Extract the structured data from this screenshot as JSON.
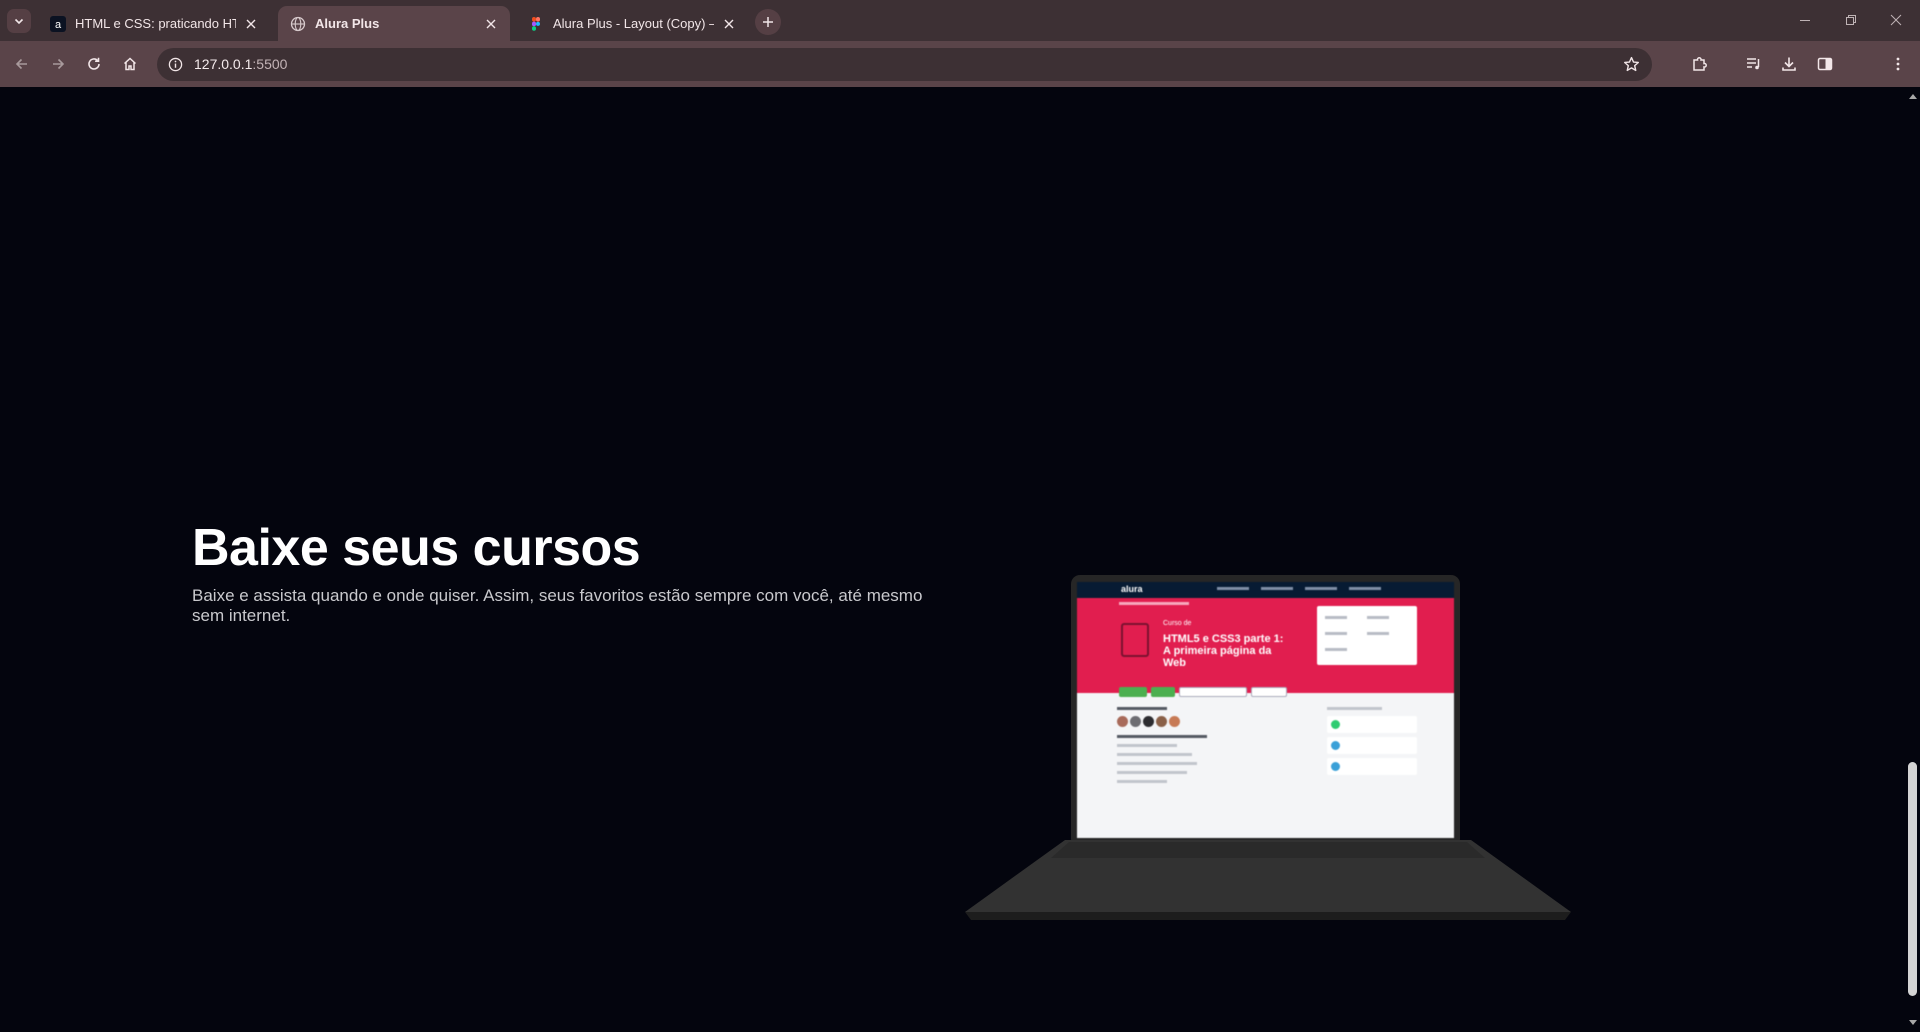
{
  "browser": {
    "tabs": [
      {
        "title": "HTML e CSS: praticando HTML",
        "favicon": "alura-icon",
        "active": false
      },
      {
        "title": "Alura Plus",
        "favicon": "globe-icon",
        "active": true
      },
      {
        "title": "Alura Plus - Layout (Copy) – Fi",
        "favicon": "figma-icon",
        "active": false
      }
    ],
    "address": {
      "host": "127.0.0.1",
      "port": ":5500"
    }
  },
  "page": {
    "title": "Baixe seus cursos",
    "description": "Baixe e assista quando e onde quiser. Assim, seus favoritos estão sempre com você, até mesmo sem internet."
  },
  "laptop_screen": {
    "logo": "alura",
    "course_prefix": "Curso de",
    "course_title": "HTML5 e CSS3 parte 1: A primeira página da Web"
  },
  "colors": {
    "page_background": "#04050e",
    "tabbar": "#3d3034",
    "toolbar": "#5a4449",
    "screen_hero": "#e11e4f"
  }
}
